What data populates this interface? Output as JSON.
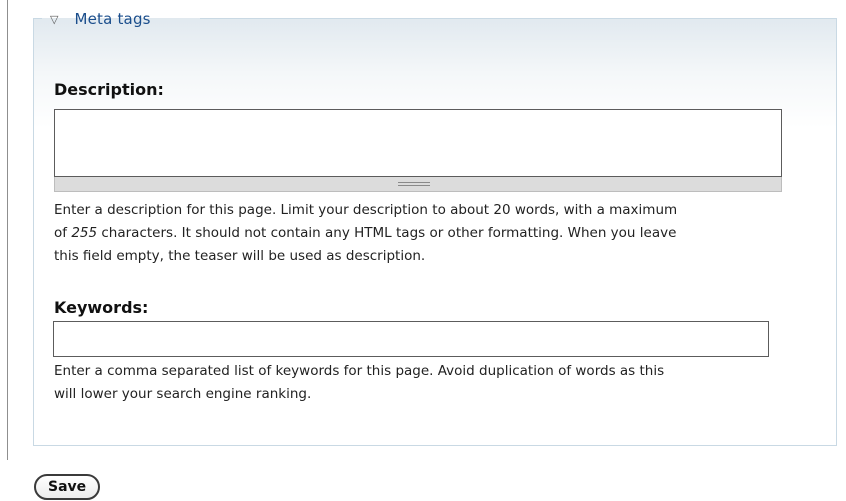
{
  "fieldset": {
    "legend": "Meta tags",
    "toggle_icon": "triangle-down-icon"
  },
  "description": {
    "label": "Description:",
    "value": "",
    "help_line1": "Enter a description for this page. Limit your description to about 20 words, with a maximum",
    "help_line2_prefix": "of ",
    "help_line2_limit": "255",
    "help_line2_suffix": " characters. It should not contain any HTML tags or other formatting. When you leave",
    "help_line3": "this field empty, the teaser will be used as description."
  },
  "keywords": {
    "label": "Keywords:",
    "value": "",
    "help_line1": "Enter a comma separated list of keywords for this page. Avoid duplication of words as this",
    "help_line2": "will lower your search engine ranking."
  },
  "actions": {
    "save_label": "Save"
  }
}
